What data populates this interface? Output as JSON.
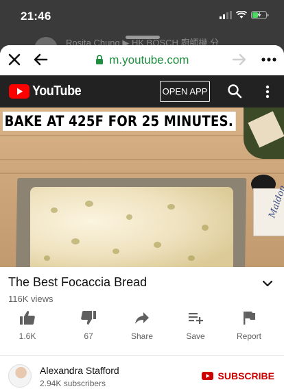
{
  "status_bar": {
    "time": "21:46"
  },
  "background_app": {
    "text": "Rosita Chung ▶ HK BOSCH 廚師機 分"
  },
  "browser": {
    "close_icon": "close-icon",
    "url": "m.youtube.com"
  },
  "youtube_header": {
    "logo_text": "YouTube",
    "open_app_label": "OPEN APP"
  },
  "video": {
    "caption": "BAKE AT 425F FOR 25 MINUTES.",
    "package_text": "Maldon"
  },
  "video_info": {
    "title": "The Best Focaccia Bread",
    "views": "116K views"
  },
  "actions": [
    {
      "label": "1.6K",
      "icon": "thumbs-up-icon"
    },
    {
      "label": "67",
      "icon": "thumbs-down-icon"
    },
    {
      "label": "Share",
      "icon": "share-icon"
    },
    {
      "label": "Save",
      "icon": "playlist-add-icon"
    },
    {
      "label": "Report",
      "icon": "flag-icon"
    }
  ],
  "channel": {
    "name": "Alexandra Stafford",
    "subscribers": "2.94K subscribers",
    "subscribe_label": "SUBSCRIBE"
  },
  "colors": {
    "accent_red": "#cc0000",
    "url_green": "#1e8e3e",
    "header_dark": "#222222"
  }
}
